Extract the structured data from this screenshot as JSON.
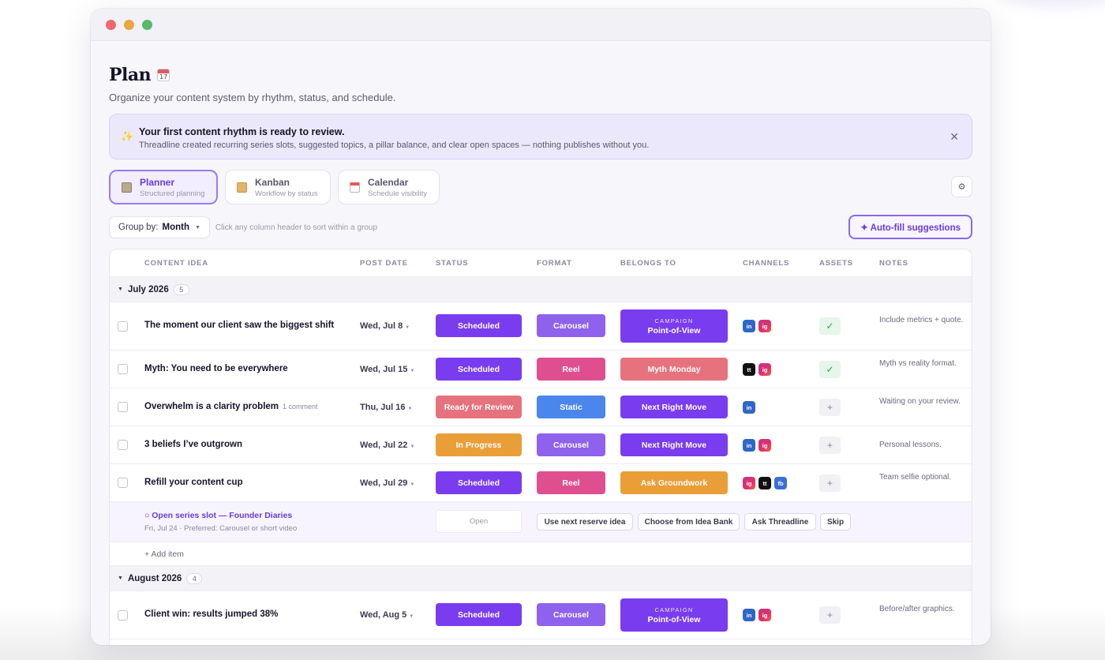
{
  "page": {
    "title": "Plan",
    "title_emoji_day": "17",
    "subtitle": "Organize your content system by rhythm, status, and schedule."
  },
  "banner": {
    "icon": "sparkle-icon",
    "title": "Your first content rhythm is ready to review.",
    "text": "Threadline created recurring series slots, suggested topics, a pillar balance, and clear open spaces — nothing publishes without you.",
    "close": "✕"
  },
  "views": [
    {
      "label": "Planner",
      "sub": "Structured planning",
      "icon": "notebook-icon",
      "active": true
    },
    {
      "label": "Kanban",
      "sub": "Workflow by status",
      "icon": "folder-icon",
      "active": false
    },
    {
      "label": "Calendar",
      "sub": "Schedule visibility",
      "icon": "calendar-icon",
      "active": false
    }
  ],
  "settings_icon": "⚙",
  "toolbar": {
    "group_by_label": "Group by:",
    "group_by_value": "Month",
    "hint": "Click any column header to sort within a group",
    "autofill": "✦ Auto-fill suggestions"
  },
  "columns": [
    "CONTENT IDEA",
    "POST DATE",
    "STATUS",
    "FORMAT",
    "BELONGS TO",
    "CHANNELS",
    "ASSETS",
    "NOTES"
  ],
  "groups": [
    {
      "name": "July 2026",
      "count": "5"
    },
    {
      "name": "August 2026",
      "count": "4"
    }
  ],
  "campaign_kicker": "CAMPAIGN",
  "rows": [
    {
      "title": "The moment our client saw the biggest shift",
      "comment": "",
      "date": "Wed, Jul 8",
      "status": "Scheduled",
      "format": "Carousel",
      "belongs": "Point-of-View",
      "belongs_campaign": true,
      "channels": [
        "in",
        "ig"
      ],
      "asset": "✓",
      "note": "Include metrics + quote."
    },
    {
      "title": "Myth: You need to be everywhere",
      "comment": "",
      "date": "Wed, Jul 15",
      "status": "Scheduled",
      "format": "Reel",
      "belongs": "Myth Monday",
      "belongs_campaign": false,
      "channels": [
        "tt",
        "ig"
      ],
      "asset": "✓",
      "note": "Myth vs reality format."
    },
    {
      "title": "Overwhelm is a clarity problem",
      "comment": "1 comment",
      "date": "Thu, Jul 16",
      "status": "Ready for Review",
      "format": "Static",
      "belongs": "Next Right Move",
      "belongs_campaign": false,
      "channels": [
        "in"
      ],
      "asset": "+",
      "note": "Waiting on your review."
    },
    {
      "title": "3 beliefs I’ve outgrown",
      "comment": "",
      "date": "Wed, Jul 22",
      "status": "In Progress",
      "format": "Carousel",
      "belongs": "Next Right Move",
      "belongs_campaign": false,
      "channels": [
        "in",
        "ig"
      ],
      "asset": "+",
      "note": "Personal lessons."
    },
    {
      "title": "Refill your content cup",
      "comment": "",
      "date": "Wed, Jul 29",
      "status": "Scheduled",
      "format": "Reel",
      "belongs": "Ask Groundwork",
      "belongs_campaign": false,
      "channels": [
        "ig",
        "tt",
        "fb"
      ],
      "asset": "+",
      "note": "Team selfie optional."
    },
    {
      "title": "Client win: results jumped 38%",
      "comment": "",
      "date": "Wed, Aug 5",
      "status": "Scheduled",
      "format": "Carousel",
      "belongs": "Point-of-View",
      "belongs_campaign": true,
      "channels": [
        "in",
        "ig"
      ],
      "asset": "+",
      "note": "Before/after graphics."
    }
  ],
  "slot": {
    "title": "○ Open series slot — Founder Diaries",
    "sub": "Fri, Jul 24 · Preferred: Carousel or short video",
    "status": "Open",
    "actions": [
      "Use next reserve idea",
      "Choose from Idea Bank",
      "Ask Threadline",
      "Skip"
    ]
  },
  "add_item": "+ Add item",
  "colors": {
    "accent": "#7a3cef",
    "scheduled": "#7a3cef",
    "ready_for_review": "#e6727d",
    "in_progress": "#ea9e37",
    "carousel": "#8e62ec",
    "reel": "#df4f8f",
    "static": "#4a86eb",
    "myth_monday": "#e6727d",
    "ask_groundwork": "#ea9e37"
  }
}
